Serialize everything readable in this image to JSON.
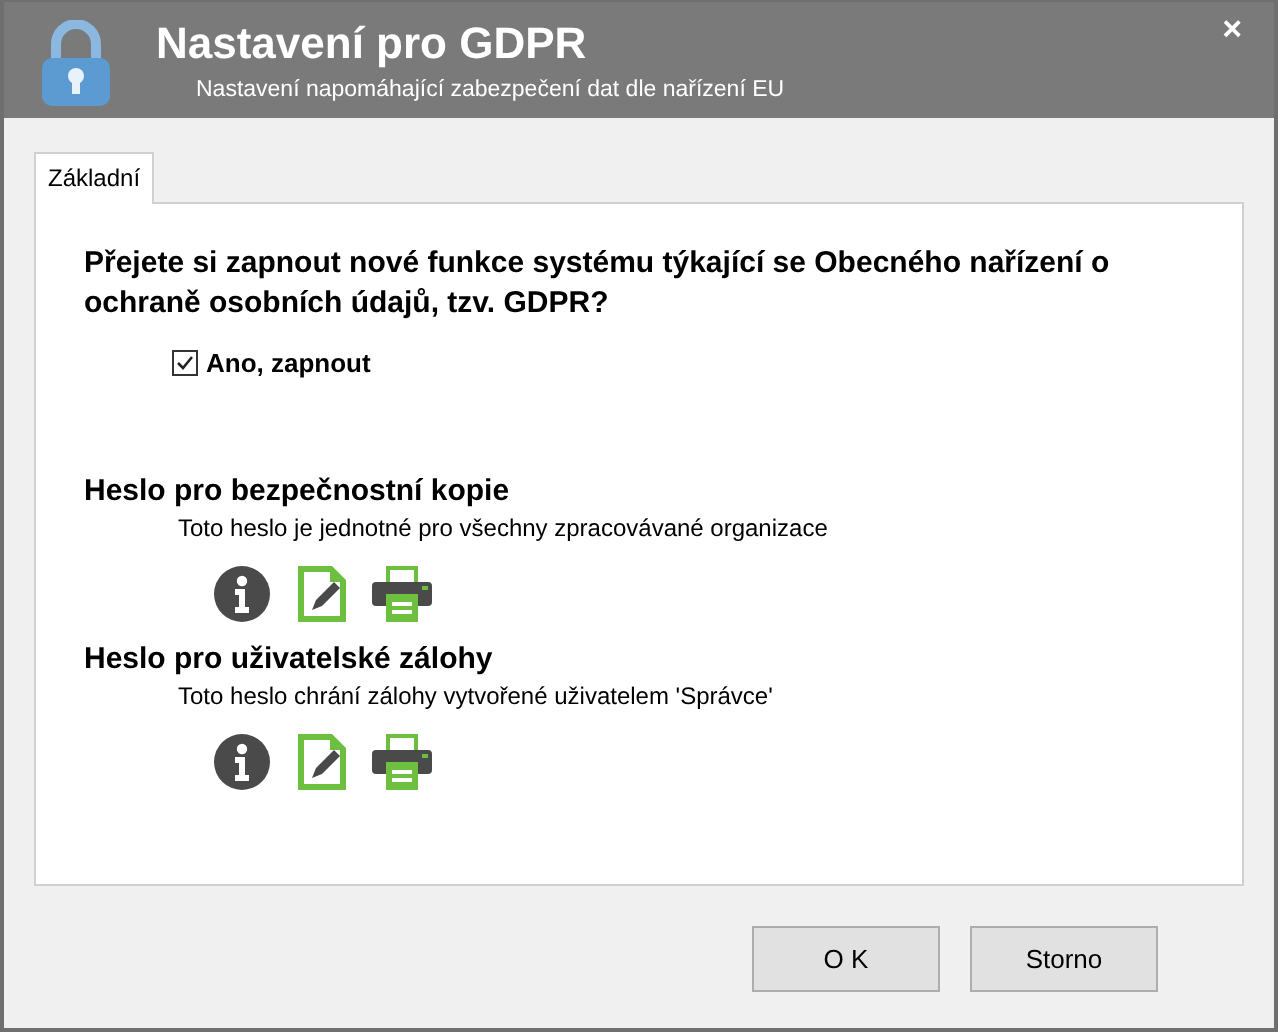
{
  "window": {
    "title": "Nastavení pro GDPR",
    "subtitle": "Nastavení napomáhající zabezpečení dat dle nařízení EU",
    "close": "×"
  },
  "tabs": [
    {
      "label": "Základní",
      "selected": true
    }
  ],
  "question": "Přejete si zapnout nové funkce systému týkající se Obecného nařízení o ochraně osobních údajů, tzv. GDPR?",
  "enable": {
    "label": "Ano, zapnout",
    "checked": true
  },
  "sections": [
    {
      "title": "Heslo pro bezpečnostní kopie",
      "description": "Toto heslo je jednotné pro všechny zpracovávané organizace"
    },
    {
      "title": "Heslo pro uživatelské zálohy",
      "description": "Toto heslo chrání zálohy vytvořené uživatelem  'Správce'"
    }
  ],
  "buttons": [
    "O K",
    "Storno"
  ]
}
